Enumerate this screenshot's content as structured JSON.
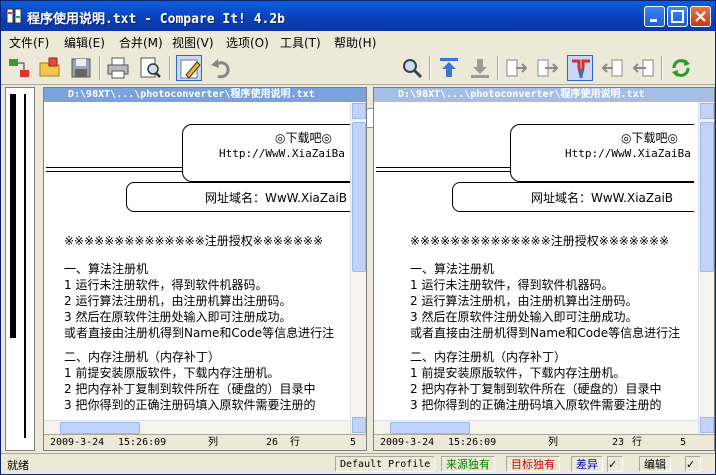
{
  "window": {
    "title": "程序使用说明.txt - Compare It! 4.2b"
  },
  "menu": [
    "文件(F)",
    "编辑(E)",
    "合并(M)",
    "视图(V)",
    "选项(O)",
    "工具(T)",
    "帮助(H)"
  ],
  "search": {
    "value": ""
  },
  "left_pane": {
    "path": "D:\\98XT\\...\\photoconverter\\程序使用说明.txt",
    "date": "2009-3-24",
    "time": "15:26:09",
    "col_label": "列",
    "col": "26",
    "row_label": "行",
    "row": "5"
  },
  "right_pane": {
    "path": "D:\\98XT\\...\\photoconverter\\程序使用说明.txt",
    "date": "2009-3-24",
    "time": "15:26:09",
    "col_label": "列",
    "col": "23",
    "row_label": "行",
    "row": "5"
  },
  "doc": {
    "box_title": "◎下载吧◎",
    "box_url": "Http://WwW.XiaZaiBa",
    "box_domain": "网址域名：WwW.XiaZaiB",
    "stars": "※※※※※※※※※※※※※※注册授权※※※※※※※",
    "sec1": "一、算法注册机",
    "l1": "1 运行未注册软件，得到软件机器码。",
    "l2": "2 运行算法注册机，由注册机算出注册码。",
    "l3": "3 然后在原软件注册处输入即可注册成功。",
    "l4": "或者直接由注册机得到Name和Code等信息进行注",
    "sec2": "二、内存注册机（内存补丁）",
    "l5": "1 前提安装原版软件，下载内存注册机。",
    "l6": "2 把内存补丁复制到软件所在（硬盘的）目录中",
    "l7": "3 把你得到的正确注册码填入原软件需要注册的"
  },
  "status": {
    "ready": "就绪",
    "profile": "Default Profile",
    "source_only": "来源独有",
    "target_only": "目标独有",
    "diff": "差异",
    "edit": "编辑"
  },
  "colors": {
    "source_only": "#008000",
    "target_only": "#d00000",
    "diff": "#0000c0"
  }
}
